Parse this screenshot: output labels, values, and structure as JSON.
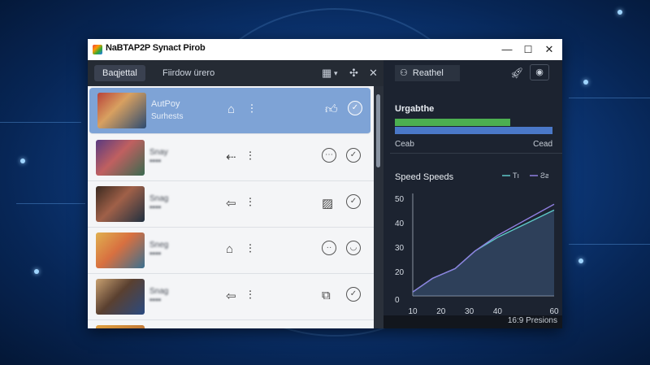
{
  "window": {
    "title": "NaBTAP2P Synact Pirob",
    "controls": {
      "minimize": "—",
      "maximize": "☐",
      "close": "✕"
    }
  },
  "toolbar": {
    "tabs": [
      {
        "label": "Baqjettal",
        "active": true
      },
      {
        "label": "Fiirdow ürero",
        "active": false
      }
    ],
    "icons": [
      "grid-icon",
      "dropdown-icon",
      "move-icon",
      "close-icon"
    ]
  },
  "list": {
    "items": [
      {
        "title": "AutPoy",
        "subtitle": "Surhests",
        "selected": true,
        "line1": "",
        "line2": ""
      },
      {
        "title": "",
        "subtitle": "",
        "selected": false,
        "line1": "Snay",
        "line2": "▪▪▪▪"
      },
      {
        "title": "",
        "subtitle": "",
        "selected": false,
        "line1": "Snag",
        "line2": "▪▪▪▪"
      },
      {
        "title": "",
        "subtitle": "",
        "selected": false,
        "line1": "Sneg",
        "line2": "▪▪▪▪"
      },
      {
        "title": "",
        "subtitle": "",
        "selected": false,
        "line1": "Snag",
        "line2": "▪▪▪▪"
      }
    ]
  },
  "right": {
    "search_label": "Reathel",
    "progress": {
      "title": "Urgabthe",
      "green_fraction": 0.73,
      "blue_fraction": 1.0,
      "left_label": "Ceab",
      "right_label": "Cead"
    },
    "status_text": "16:9 Presions"
  },
  "chart_data": {
    "type": "line",
    "title": "Speed Speeds",
    "legend": [
      {
        "label": "Tı",
        "color": "#5ec8c8"
      },
      {
        "label": "Ƨƨ",
        "color": "#8f7fe0"
      }
    ],
    "x_ticks": [
      "10",
      "20",
      "30",
      "40",
      "60"
    ],
    "y_ticks": [
      "50",
      "40",
      "30",
      "20",
      "0"
    ],
    "xlim": [
      10,
      60
    ],
    "ylim": [
      0,
      50
    ],
    "grid": false,
    "series": [
      {
        "name": "Tı",
        "color": "#5ec8c8",
        "x": [
          10,
          17,
          25,
          32,
          40,
          50,
          60
        ],
        "y": [
          2,
          9,
          14,
          23,
          30,
          37,
          44
        ]
      },
      {
        "name": "Ƨƨ",
        "color": "#8f7fe0",
        "x": [
          10,
          17,
          25,
          32,
          40,
          50,
          60
        ],
        "y": [
          2,
          9,
          14,
          23,
          31,
          39,
          47
        ]
      }
    ]
  },
  "colors": {
    "accent_green": "#4caf50",
    "accent_blue": "#4a78c8",
    "selected_row": "#7ea3d6"
  }
}
